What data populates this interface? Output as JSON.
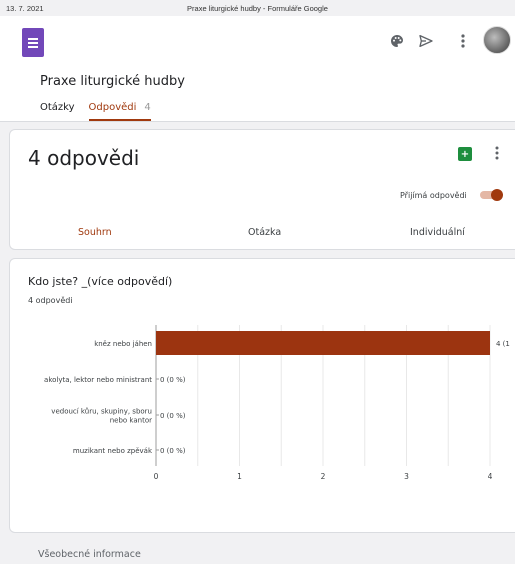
{
  "print": {
    "date": "13. 7. 2021",
    "title": "Praxe liturgické hudby - Formuláře Google"
  },
  "app": {
    "form_title": "Praxe liturgické hudby",
    "tabs": [
      {
        "label": "Otázky"
      },
      {
        "label": "Odpovědi",
        "count": "4"
      }
    ]
  },
  "icons": {
    "palette": "palette-icon",
    "send": "send-icon",
    "more": "more-vert-icon",
    "sheets": "sheets-icon"
  },
  "summary": {
    "responses_title": "4 odpovědi",
    "accepting_label": "Přijímá odpovědi",
    "accepting": true,
    "subtabs": [
      "Souhrn",
      "Otázka",
      "Individuální"
    ]
  },
  "question": {
    "title": "Kdo jste? _(více odpovědí)",
    "response_count": "4 odpovědi"
  },
  "chart_data": {
    "type": "bar",
    "orientation": "horizontal",
    "categories": [
      [
        "kněz nebo jáhen"
      ],
      [
        "akolyta, lektor nebo ministrant"
      ],
      [
        "vedoucí kůru, skupiny, sboru",
        "nebo kantor"
      ],
      [
        "muzikant nebo zpěvák"
      ]
    ],
    "values": [
      4,
      0,
      0,
      0
    ],
    "value_labels": [
      "4 (1",
      "0 (0 %)",
      "0 (0 %)",
      "0 (0 %)"
    ],
    "xlim": [
      0,
      4
    ],
    "xticks": [
      "0",
      "1",
      "2",
      "3",
      "4"
    ],
    "grid": true,
    "bar_color": "#9c3410"
  },
  "section": {
    "label": "Všeobecné informace"
  },
  "colors": {
    "accent": "#a0390e",
    "forms_purple": "#7248b9",
    "sheets_green": "#1e8e3e"
  }
}
